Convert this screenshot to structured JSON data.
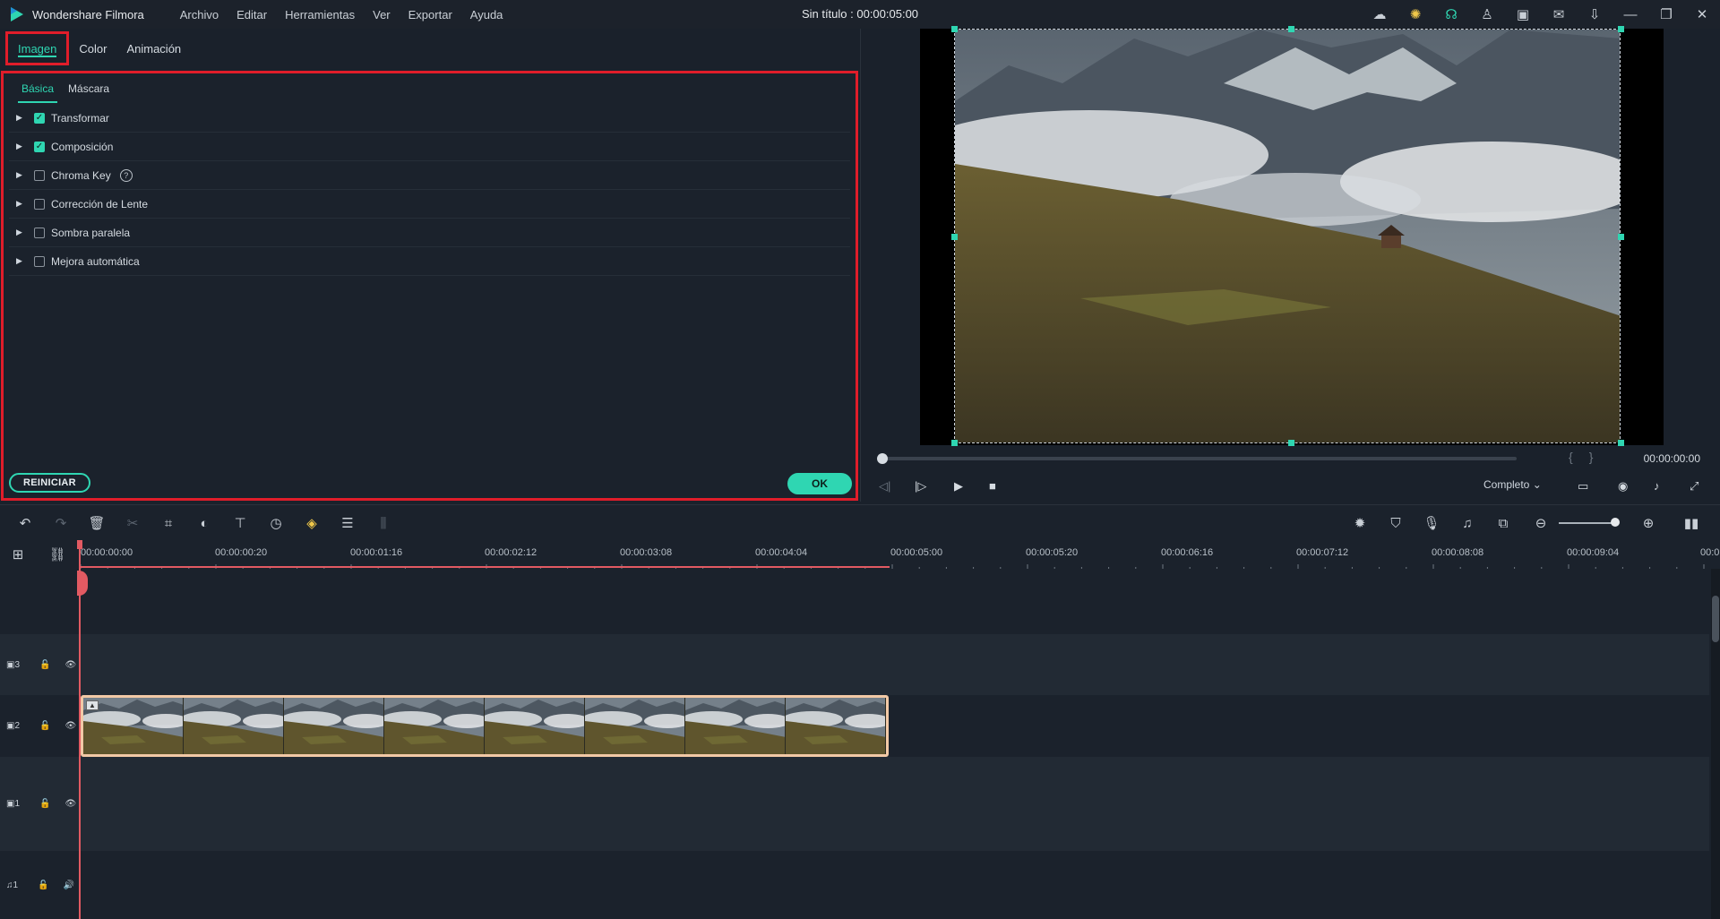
{
  "app": {
    "name": "Wondershare Filmora",
    "document_title": "Sin título : 00:00:05:00",
    "menu": [
      "Archivo",
      "Editar",
      "Herramientas",
      "Ver",
      "Exportar",
      "Ayuda"
    ]
  },
  "panel": {
    "tabs": [
      "Imagen",
      "Color",
      "Animación"
    ],
    "subtabs": [
      "Básica",
      "Máscara"
    ],
    "properties": [
      {
        "label": "Transformar",
        "checked": true
      },
      {
        "label": "Composición",
        "checked": true
      },
      {
        "label": "Chroma Key",
        "checked": false,
        "help": "?"
      },
      {
        "label": "Corrección de Lente",
        "checked": false
      },
      {
        "label": "Sombra paralela",
        "checked": false
      },
      {
        "label": "Mejora automática",
        "checked": false
      }
    ],
    "reset_label": "REINICIAR",
    "ok_label": "OK",
    "accent": "#2fd6b2",
    "highlight": "#e01d2a"
  },
  "preview": {
    "timecode": "00:00:00:00",
    "quality": "Completo",
    "bracket_in": "{",
    "bracket_out": "}"
  },
  "timeline": {
    "ruler_labels": [
      "00:00:00:00",
      "00:00:00:20",
      "00:00:01:16",
      "00:00:02:12",
      "00:00:03:08",
      "00:00:04:04",
      "00:00:05:00",
      "00:00:05:20",
      "00:00:06:16",
      "00:00:07:12",
      "00:00:08:08",
      "00:00:09:04",
      "00:0"
    ],
    "tracks": [
      {
        "label": "3",
        "type": "video"
      },
      {
        "label": "2",
        "type": "video"
      },
      {
        "label": "1",
        "type": "video"
      },
      {
        "label": "1",
        "type": "audio"
      }
    ],
    "clip_color": "#f2c9a6"
  }
}
